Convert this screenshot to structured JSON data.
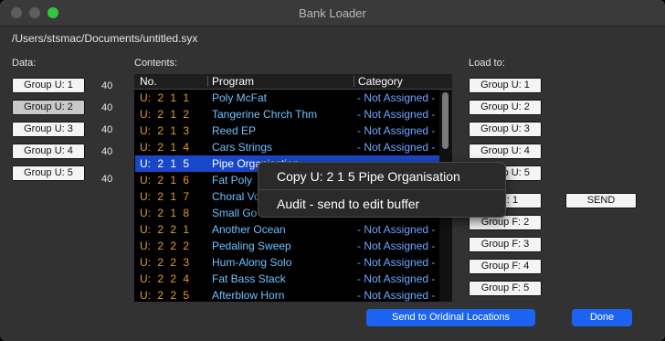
{
  "window": {
    "title": "Bank Loader"
  },
  "file_path": "/Users/stsmac/Documents/untitled.syx",
  "labels": {
    "data": "Data:",
    "contents": "Contents:",
    "load_to": "Load to:"
  },
  "data_groups": [
    {
      "label": "Group U: 1",
      "count": "40"
    },
    {
      "label": "Group U: 2",
      "count": "40"
    },
    {
      "label": "Group U: 3",
      "count": "40"
    },
    {
      "label": "Group U: 4",
      "count": "40"
    },
    {
      "label": "Group U: 5",
      "count": "40"
    }
  ],
  "table": {
    "headers": {
      "no": "No.",
      "program": "Program",
      "category": "Category"
    },
    "rows": [
      {
        "no": "U: 2 1 1",
        "program": "Poly McFat",
        "category": "- Not Assigned -"
      },
      {
        "no": "U: 2 1 2",
        "program": "Tangerine Chrch Thm",
        "category": "- Not Assigned -"
      },
      {
        "no": "U: 2 1 3",
        "program": "Reed EP",
        "category": "- Not Assigned -"
      },
      {
        "no": "U: 2 1 4",
        "program": "Cars Strings",
        "category": "- Not Assigned -"
      },
      {
        "no": "U: 2 1 5",
        "program": "Pipe Organisation",
        "category": ""
      },
      {
        "no": "U: 2 1 6",
        "program": "Fat Poly",
        "category": ""
      },
      {
        "no": "U: 2 1 7",
        "program": "Choral Vo",
        "category": ""
      },
      {
        "no": "U: 2 1 8",
        "program": "Small Go",
        "category": ""
      },
      {
        "no": "U: 2 2 1",
        "program": "Another Ocean",
        "category": "- Not Assigned -"
      },
      {
        "no": "U: 2 2 2",
        "program": "Pedaling Sweep",
        "category": "- Not Assigned -"
      },
      {
        "no": "U: 2 2 3",
        "program": "Hum-Along Solo",
        "category": "- Not Assigned -"
      },
      {
        "no": "U: 2 2 4",
        "program": "Fat Bass Stack",
        "category": "- Not Assigned -"
      },
      {
        "no": "U: 2 2 5",
        "program": "Afterblow Horn",
        "category": "- Not Assigned -"
      }
    ]
  },
  "load_to": [
    "Group U: 1",
    "Group U: 2",
    "Group U: 3",
    "Group U: 4",
    "Group U: 5",
    "p F: 1",
    "Group F: 2",
    "Group F: 3",
    "Group F: 4",
    "Group F: 5"
  ],
  "buttons": {
    "send": "SEND",
    "send_original": "Send to Oridinal Locations",
    "done": "Done"
  },
  "context_menu": {
    "copy": "Copy  U: 2  1  5  Pipe Organisation",
    "audit": "Audit - send to edit buffer"
  },
  "colors": {
    "accent": "#1c63f2",
    "selection": "#1848c9",
    "number": "#e39b2c",
    "program": "#6fc0ff",
    "category": "#6fa6ff"
  }
}
